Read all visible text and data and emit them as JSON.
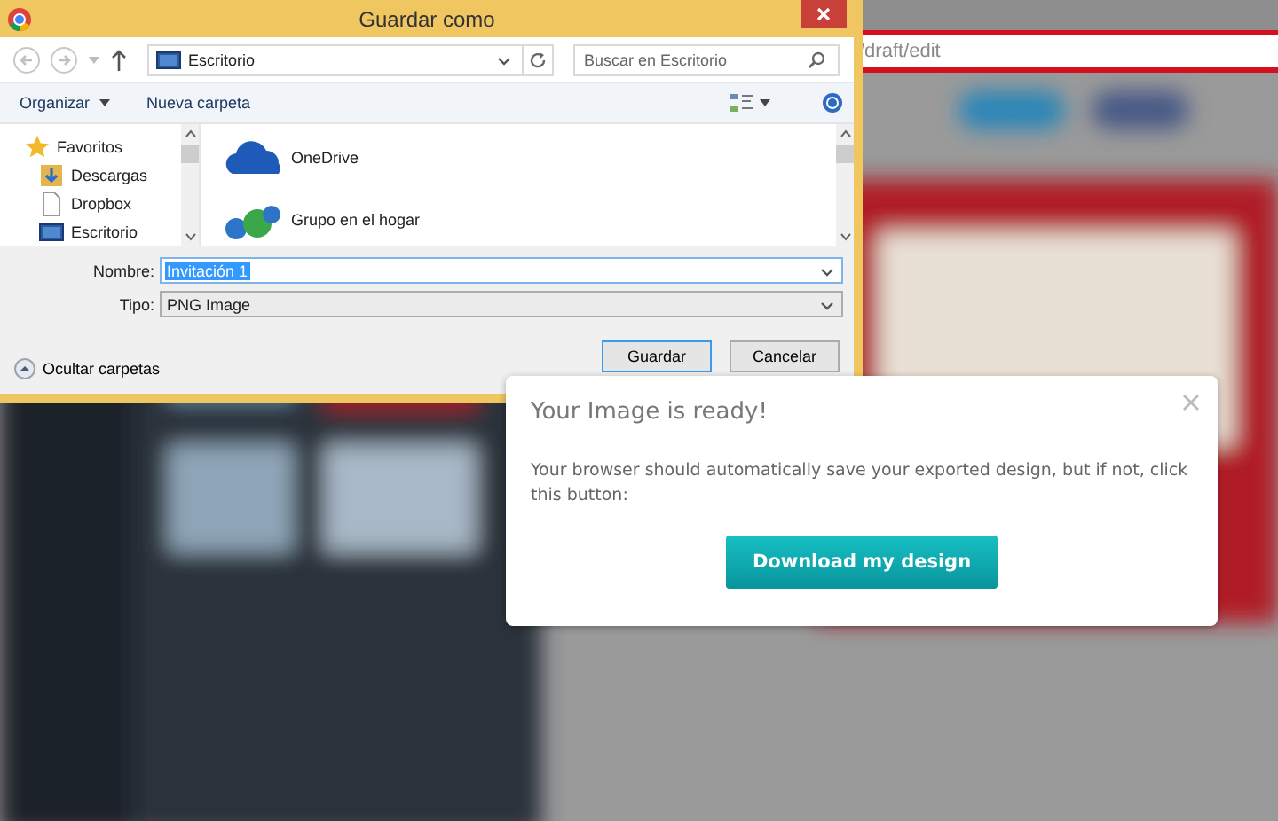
{
  "background_page": {
    "address": "/draft/edit"
  },
  "dialog": {
    "title": "Guardar como",
    "location": "Escritorio",
    "search": {
      "placeholder": "Buscar en Escritorio"
    },
    "toolbar": [
      {
        "label": "Organizar",
        "dropdown": true
      },
      {
        "label": "Nueva carpeta",
        "dropdown": false
      }
    ],
    "nav_items": [
      {
        "label": "Favoritos",
        "kind": "star",
        "children": [
          {
            "label": "Descargas",
            "kind": "downloads"
          },
          {
            "label": "Dropbox",
            "kind": "file"
          },
          {
            "label": "Escritorio",
            "kind": "desktop"
          }
        ]
      }
    ],
    "folders": [
      {
        "label": "OneDrive",
        "kind": "cloud"
      },
      {
        "label": "Grupo en el hogar",
        "kind": "homegroup"
      }
    ],
    "fields": [
      {
        "label": "Nombre:",
        "value": "Invitación 1",
        "kind": "text",
        "selected": true
      },
      {
        "label": "Tipo:",
        "value": "PNG Image",
        "kind": "select",
        "selected": false
      }
    ],
    "hide_folders": "Ocultar carpetas",
    "buttons": [
      {
        "label": "Guardar",
        "default": true
      },
      {
        "label": "Cancelar",
        "default": false
      }
    ]
  },
  "modal": {
    "title": "Your Image is ready!",
    "message": "Your browser should automatically save your exported design, but if not, click this button:",
    "button": "Download my design"
  }
}
